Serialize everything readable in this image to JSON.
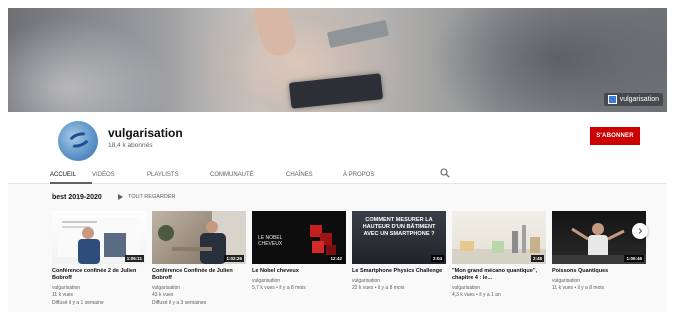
{
  "banner": {
    "watermark": "vulgarisation"
  },
  "channel": {
    "name": "vulgarisation",
    "subscribers": "18,4 k abonnés",
    "subscribe_label": "S'ABONNER"
  },
  "tabs": [
    "ACCUEIL",
    "VIDÉOS",
    "PLAYLISTS",
    "COMMUNAUTÉ",
    "CHAÎNES",
    "À PROPOS"
  ],
  "section": {
    "title": "best 2019-2020",
    "play_all_label": "TOUT REGARDER"
  },
  "videos": [
    {
      "title": "Conférence confinée 2 de Julien Bobroff",
      "channel": "vulgarisation",
      "views": "11 k vues",
      "age": "Diffusé il y a 1 semaine",
      "duration": "1:06:11"
    },
    {
      "title": "Conférence Confinée de Julien Bobroff",
      "channel": "vulgarisation",
      "views": "43 k vues",
      "age": "Diffusé il y a 3 semaines",
      "duration": "1:02:26"
    },
    {
      "title": "Le Nobel cheveux",
      "channel": "vulgarisation",
      "views": "5,7 k vues • il y a 8 mois",
      "age": "",
      "duration": "12:42",
      "thumb_text": "LE NOBEL CHEVEUX"
    },
    {
      "title": "Le Smartphone Physics Challenge",
      "channel": "vulgarisation",
      "views": "22 k vues • il y a 8 mois",
      "age": "",
      "duration": "2:04",
      "thumb_text": "COMMENT MESURER LA HAUTEUR D'UN BÂTIMENT AVEC UN SMARTPHONE ?"
    },
    {
      "title": "\"Mon grand mécano quantique\", chapitre 4 : le...",
      "channel": "vulgarisation",
      "views": "4,3 k vues • il y a 1 an",
      "age": "",
      "duration": "2:48"
    },
    {
      "title": "Poissons Quantiques",
      "channel": "vulgarisation",
      "views": "11 k vues • il y a 8 mois",
      "age": "",
      "duration": "1:06:46"
    }
  ],
  "icons": {
    "search": "search-icon",
    "next": "chevron-right-icon",
    "play": "play-icon"
  },
  "colors": {
    "subscribe": "#cc0000",
    "text_secondary": "#606060"
  }
}
